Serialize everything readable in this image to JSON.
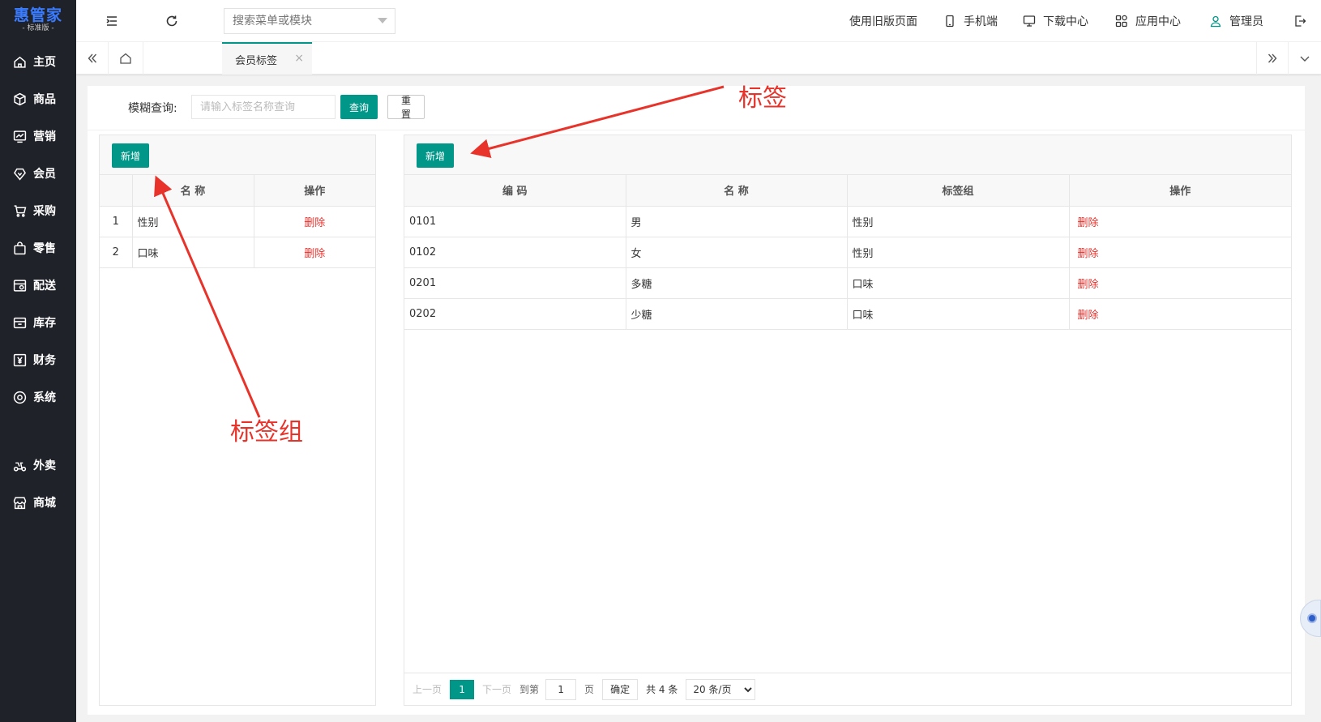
{
  "logo": {
    "title": "惠管家",
    "subtitle": "- 标准版 -"
  },
  "sidebar": {
    "items": [
      {
        "label": "主页",
        "icon": "home-icon"
      },
      {
        "label": "商品",
        "icon": "box-icon"
      },
      {
        "label": "营销",
        "icon": "chart-icon"
      },
      {
        "label": "会员",
        "icon": "diamond-icon"
      },
      {
        "label": "采购",
        "icon": "cart-icon"
      },
      {
        "label": "零售",
        "icon": "bag-icon"
      },
      {
        "label": "配送",
        "icon": "delivery-icon"
      },
      {
        "label": "库存",
        "icon": "inventory-icon"
      },
      {
        "label": "财务",
        "icon": "yen-icon"
      },
      {
        "label": "系统",
        "icon": "system-icon"
      },
      {
        "label": "外卖",
        "icon": "scooter-icon"
      },
      {
        "label": "商城",
        "icon": "store-icon"
      }
    ]
  },
  "header": {
    "search_placeholder": "搜索菜单或模块",
    "links": {
      "old_page": "使用旧版页面",
      "mobile": "手机端",
      "download": "下载中心",
      "apps": "应用中心",
      "user": "管理员"
    }
  },
  "tabs": {
    "active": "会员标签",
    "close_glyph": "×"
  },
  "query": {
    "label": "模糊查询:",
    "placeholder": "请输入标签名称查询",
    "search_button": "查询",
    "reset_button": "重置"
  },
  "left_panel": {
    "add_button": "新增",
    "columns": [
      "",
      "名 称",
      "操作"
    ],
    "rows": [
      {
        "index": "1",
        "name": "性别",
        "action": "删除"
      },
      {
        "index": "2",
        "name": "口味",
        "action": "删除"
      }
    ]
  },
  "right_panel": {
    "add_button": "新增",
    "columns": [
      "编 码",
      "名 称",
      "标签组",
      "操作"
    ],
    "rows": [
      {
        "code": "0101",
        "name": "男",
        "group": "性别",
        "action": "删除"
      },
      {
        "code": "0102",
        "name": "女",
        "group": "性别",
        "action": "删除"
      },
      {
        "code": "0201",
        "name": "多糖",
        "group": "口味",
        "action": "删除"
      },
      {
        "code": "0202",
        "name": "少糖",
        "group": "口味",
        "action": "删除"
      }
    ],
    "pagination": {
      "prev": "上一页",
      "current": "1",
      "next": "下一页",
      "goto": "到第",
      "page_value": "1",
      "page_unit": "页",
      "confirm": "确定",
      "total": "共 4 条",
      "page_size": "20 条/页"
    }
  },
  "annotations": {
    "tag": "标签",
    "tag_group": "标签组"
  },
  "colors": {
    "primary": "#009688",
    "sidebar_bg": "#20222a",
    "danger": "#e2322c",
    "annotation": "#e8332b",
    "logo": "#3a7cff"
  }
}
